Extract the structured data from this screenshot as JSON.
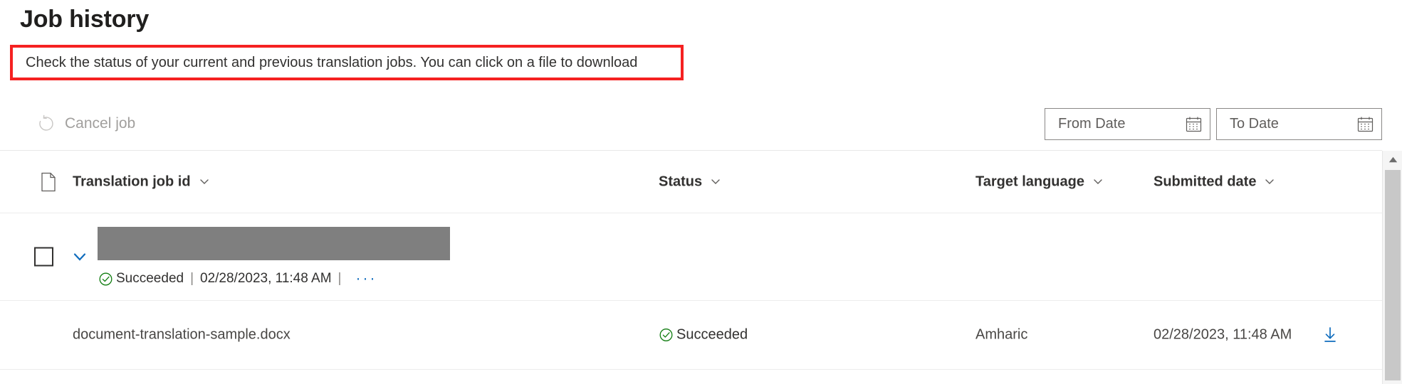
{
  "page": {
    "title": "Job history",
    "description": "Check the status of your current and previous translation jobs. You can click on a file to download",
    "highlight_color": "#f52121"
  },
  "toolbar": {
    "cancel_job_label": "Cancel job",
    "cancel_job_enabled": false,
    "from_date_placeholder": "From Date",
    "from_date_value": "",
    "to_date_placeholder": "To Date",
    "to_date_value": ""
  },
  "table": {
    "columns": [
      {
        "key": "job_id",
        "label": "Translation job id",
        "sortable": true
      },
      {
        "key": "status",
        "label": "Status",
        "sortable": true
      },
      {
        "key": "target_language",
        "label": "Target language",
        "sortable": true
      },
      {
        "key": "submitted_date",
        "label": "Submitted date",
        "sortable": true
      }
    ],
    "rows": [
      {
        "type": "job",
        "job_id": "",
        "job_id_redacted": true,
        "checkbox_checked": false,
        "expanded": true,
        "status": "Succeeded",
        "submitted_date": "02/28/2023, 11:48 AM",
        "separator": "|",
        "overflow_menu": "···"
      },
      {
        "type": "document",
        "file_name": "document-translation-sample.docx",
        "status": "Succeeded",
        "target_language": "Amharic",
        "submitted_date": "02/28/2023, 11:48 AM",
        "download_available": true
      }
    ]
  },
  "colors": {
    "success": "#107c10",
    "link": "#0f6cbd",
    "text": "#323130",
    "muted": "#605e5c",
    "disabled": "#a19f9d",
    "redaction": "#7f7f7f"
  },
  "scrollbar": {
    "orientation": "vertical",
    "position": "right"
  }
}
